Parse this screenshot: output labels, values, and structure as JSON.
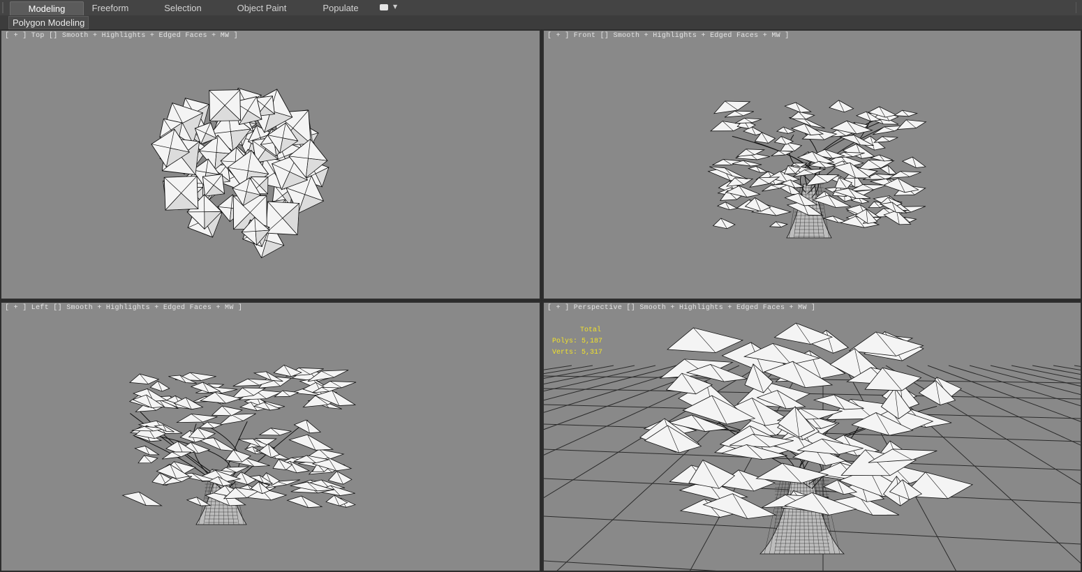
{
  "ribbon": {
    "tabs": [
      {
        "label": "Modeling",
        "active": true
      },
      {
        "label": "Freeform",
        "active": false
      },
      {
        "label": "Selection",
        "active": false
      },
      {
        "label": "Object Paint",
        "active": false
      },
      {
        "label": "Populate",
        "active": false
      }
    ],
    "panel_label": "Polygon Modeling"
  },
  "viewports": {
    "top": {
      "label": "[ + ] Top [] Smooth + Highlights + Edged Faces + MW ]"
    },
    "front": {
      "label": "[ + ] Front [] Smooth + Highlights + Edged Faces + MW ]"
    },
    "left": {
      "label": "[ + ] Left [] Smooth + Highlights + Edged Faces + MW ]"
    },
    "perspective": {
      "label": "[ + ] Perspective [] Smooth + Highlights + Edged Faces + MW ]"
    }
  },
  "stats": {
    "total": "Total",
    "polys": "Polys: 5,187",
    "verts": "Verts: 5,317"
  },
  "colors": {
    "viewport_bg": "#898989",
    "stats_text": "#f1e22a",
    "leaf_fill": "#f4f4f4"
  }
}
